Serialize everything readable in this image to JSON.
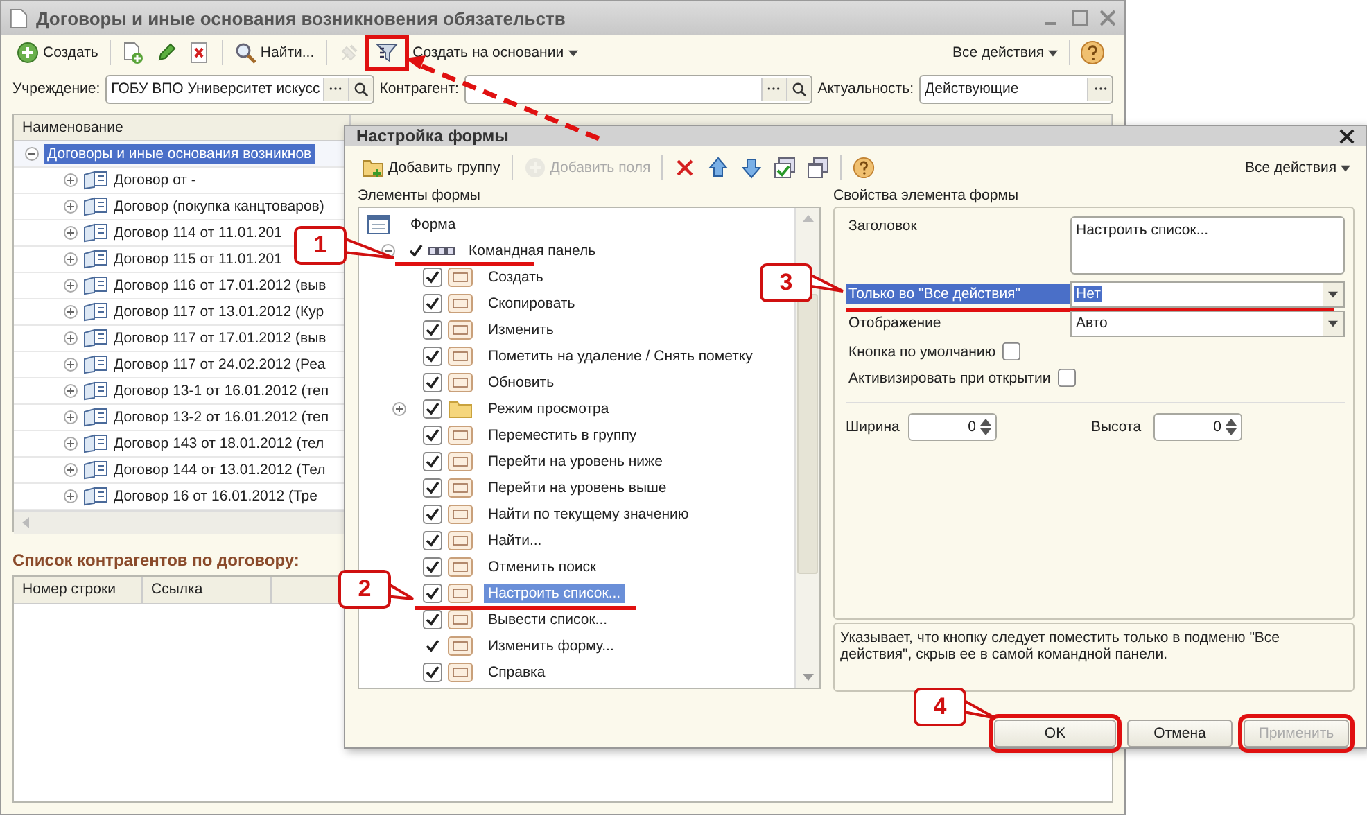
{
  "main_window": {
    "title": "Договоры и иные основания возникновения обязательств",
    "toolbar": [
      {
        "kind": "create",
        "label": "Создать"
      },
      {
        "kind": "copy"
      },
      {
        "kind": "edit"
      },
      {
        "kind": "delete"
      },
      {
        "kind": "find",
        "label": "Найти..."
      },
      {
        "kind": "plug",
        "disabled": true
      },
      {
        "kind": "filter",
        "marked": true
      },
      {
        "kind": "menu",
        "label": "Создать на основании"
      }
    ],
    "all_actions": "Все действия",
    "filters": [
      {
        "label": "Учреждение:",
        "value": "ГОБУ ВПО Университет искусс",
        "search": true
      },
      {
        "label": "Контрагент:",
        "search": true
      },
      {
        "label": "Актуальность:",
        "value": "Действующие",
        "search": false
      }
    ],
    "table": {
      "columns": [
        "Наименование"
      ],
      "group_row": {
        "label": "Договоры и иные основания возникнов",
        "expanded": true,
        "selected": true
      },
      "rows": [
        {
          "label": "Договор  от -",
          "expanded": false
        },
        {
          "label": "Договор (покупка канцтоваров)",
          "expanded": false
        },
        {
          "label": "Договор 114 от 11.01.201",
          "expanded": false
        },
        {
          "label": "Договор 115 от 11.01.201",
          "expanded": false
        },
        {
          "label": "Договор 116 от 17.01.2012 (выв",
          "expanded": false
        },
        {
          "label": "Договор 117 от 13.01.2012 (Кур",
          "expanded": false
        },
        {
          "label": "Договор 117 от 17.01.2012 (выв",
          "expanded": false
        },
        {
          "label": "Договор 117 от 24.02.2012 (Реа",
          "expanded": false
        },
        {
          "label": "Договор 13-1 от 16.01.2012 (теп",
          "expanded": false
        },
        {
          "label": "Договор 13-2 от 16.01.2012 (теп",
          "expanded": false
        },
        {
          "label": "Договор 143 от 18.01.2012 (тел",
          "expanded": false
        },
        {
          "label": "Договор 144 от 13.01.2012 (Тел",
          "expanded": false
        },
        {
          "label": "Договор 16 от 16.01.2012 (Тре",
          "expanded": false
        }
      ]
    },
    "sublist": {
      "title": "Список контрагентов по договору:",
      "columns": [
        "Номер строки",
        "Ссылка"
      ]
    }
  },
  "dialog": {
    "title": "Настройка формы",
    "toolbar": [
      {
        "kind": "add-group",
        "label": "Добавить группу"
      },
      {
        "kind": "add-field",
        "label": "Добавить поля",
        "disabled": true
      },
      {
        "kind": "delete"
      },
      {
        "kind": "up"
      },
      {
        "kind": "down"
      },
      {
        "kind": "check-all"
      },
      {
        "kind": "windows"
      },
      {
        "kind": "help"
      }
    ],
    "all_actions": "Все действия",
    "tree_title": "Элементы формы",
    "tree": {
      "label": "Форма",
      "children": [
        {
          "label": "Командная панель",
          "kind": "panel",
          "checked": true,
          "expanded": true,
          "underlined": true,
          "children": [
            {
              "label": "Создать",
              "kind": "command",
              "checked": true,
              "fixed": false,
              "selected": false,
              "underlined": false
            },
            {
              "label": "Скопировать",
              "kind": "command",
              "checked": true,
              "fixed": false,
              "selected": false,
              "underlined": false
            },
            {
              "label": "Изменить",
              "kind": "command",
              "checked": true,
              "fixed": false,
              "selected": false,
              "underlined": false
            },
            {
              "label": "Пометить на удаление / Снять пометку",
              "kind": "command",
              "checked": true,
              "fixed": false,
              "selected": false,
              "underlined": false
            },
            {
              "label": "Обновить",
              "kind": "command",
              "checked": true,
              "fixed": false,
              "selected": false,
              "underlined": false
            },
            {
              "label": "Режим просмотра",
              "kind": "group",
              "checked": true,
              "fixed": false,
              "selected": false,
              "underlined": false,
              "expanded": false
            },
            {
              "label": "Переместить в группу",
              "kind": "command",
              "checked": true,
              "fixed": false,
              "selected": false,
              "underlined": false
            },
            {
              "label": "Перейти на уровень ниже",
              "kind": "command",
              "checked": true,
              "fixed": false,
              "selected": false,
              "underlined": false
            },
            {
              "label": "Перейти на уровень выше",
              "kind": "command",
              "checked": true,
              "fixed": false,
              "selected": false,
              "underlined": false
            },
            {
              "label": "Найти по текущему значению",
              "kind": "command",
              "checked": true,
              "fixed": false,
              "selected": false,
              "underlined": false
            },
            {
              "label": "Найти...",
              "kind": "command",
              "checked": true,
              "fixed": false,
              "selected": false,
              "underlined": false
            },
            {
              "label": "Отменить поиск",
              "kind": "command",
              "checked": true,
              "fixed": false,
              "selected": false,
              "underlined": false
            },
            {
              "label": "Настроить список...",
              "kind": "command",
              "checked": true,
              "fixed": false,
              "selected": true,
              "underlined": true
            },
            {
              "label": "Вывести список...",
              "kind": "command",
              "checked": true,
              "fixed": false,
              "selected": false,
              "underlined": false
            },
            {
              "label": "Изменить форму...",
              "kind": "command",
              "checked": true,
              "fixed": true,
              "selected": false,
              "underlined": false
            },
            {
              "label": "Справка",
              "kind": "command",
              "checked": true,
              "fixed": false,
              "selected": false,
              "underlined": false
            }
          ]
        }
      ]
    },
    "props_title": "Свойства элемента формы",
    "properties": [
      {
        "kind": "text",
        "label": "Заголовок",
        "value": "Настроить список..."
      },
      {
        "kind": "select",
        "label": "Только во \"Все действия\"",
        "value": "Нет",
        "selected": true,
        "underlined": true
      },
      {
        "kind": "select",
        "label": "Отображение",
        "value": "Авто",
        "selected": false,
        "underlined": false
      },
      {
        "kind": "checkbox",
        "label": "Кнопка по умолчанию",
        "checked": false
      },
      {
        "kind": "checkbox",
        "label": "Активизировать при открытии",
        "checked": false
      }
    ],
    "size": [
      {
        "label": "Ширина",
        "value": "0"
      },
      {
        "label": "Высота",
        "value": "0"
      }
    ],
    "description": "Указывает, что кнопку следует поместить только в подменю \"Все действия\", скрыв ее в самой командной панели.",
    "buttons": [
      {
        "label": "OK",
        "disabled": false,
        "marked": true
      },
      {
        "label": "Отмена",
        "disabled": false,
        "marked": false
      },
      {
        "label": "Применить",
        "disabled": true,
        "marked": true
      }
    ]
  },
  "callouts": [
    "1",
    "2",
    "3",
    "4"
  ]
}
